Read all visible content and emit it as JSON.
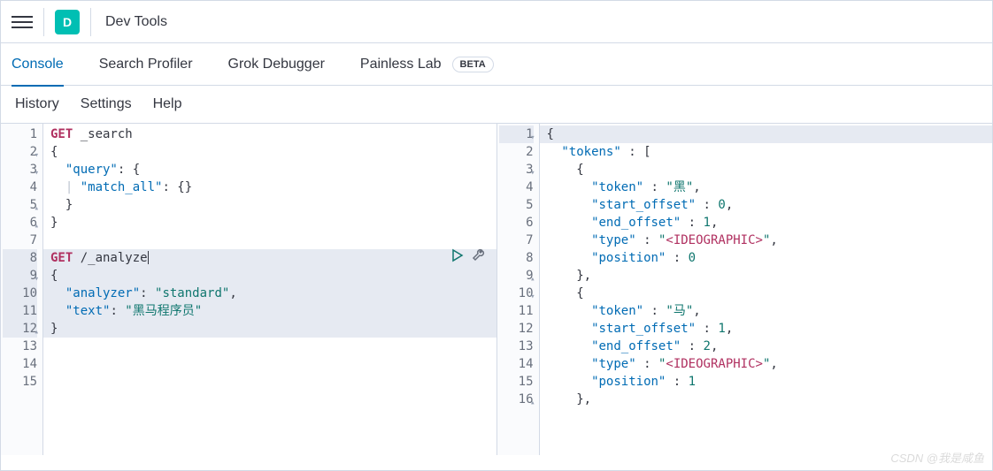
{
  "header": {
    "logo_letter": "D",
    "title": "Dev Tools"
  },
  "tabs": [
    {
      "label": "Console",
      "active": true
    },
    {
      "label": "Search Profiler"
    },
    {
      "label": "Grok Debugger"
    },
    {
      "label": "Painless Lab",
      "badge": "BETA"
    }
  ],
  "subtabs": [
    "History",
    "Settings",
    "Help"
  ],
  "request": {
    "lines": [
      {
        "n": 1,
        "tokens": [
          {
            "t": "GET ",
            "c": "method"
          },
          {
            "t": "_search",
            "c": "punct"
          }
        ]
      },
      {
        "n": 2,
        "fold": "▾",
        "tokens": [
          {
            "t": "{",
            "c": "punct"
          }
        ]
      },
      {
        "n": 3,
        "fold": "▾",
        "tokens": [
          {
            "t": "  ",
            "c": ""
          },
          {
            "t": "\"query\"",
            "c": "key"
          },
          {
            "t": ": {",
            "c": "punct"
          }
        ]
      },
      {
        "n": 4,
        "tokens": [
          {
            "t": "  ",
            "c": ""
          },
          {
            "t": "| ",
            "c": "pipe"
          },
          {
            "t": "\"match_all\"",
            "c": "key"
          },
          {
            "t": ": {}",
            "c": "punct"
          }
        ]
      },
      {
        "n": 5,
        "fold": "▴",
        "tokens": [
          {
            "t": "  }",
            "c": "punct"
          }
        ]
      },
      {
        "n": 6,
        "fold": "▴",
        "tokens": [
          {
            "t": "}",
            "c": "punct"
          }
        ]
      },
      {
        "n": 7,
        "tokens": []
      },
      {
        "n": 8,
        "hl": true,
        "cursor": true,
        "tokens": [
          {
            "t": "GET ",
            "c": "method"
          },
          {
            "t": "/_analyze",
            "c": "punct"
          }
        ]
      },
      {
        "n": 9,
        "hl": true,
        "fold": "▾",
        "tokens": [
          {
            "t": "{",
            "c": "punct"
          }
        ]
      },
      {
        "n": 10,
        "hl": true,
        "tokens": [
          {
            "t": "  ",
            "c": ""
          },
          {
            "t": "\"analyzer\"",
            "c": "key"
          },
          {
            "t": ": ",
            "c": "punct"
          },
          {
            "t": "\"standard\"",
            "c": "str"
          },
          {
            "t": ",",
            "c": "punct"
          }
        ]
      },
      {
        "n": 11,
        "hl": true,
        "tokens": [
          {
            "t": "  ",
            "c": ""
          },
          {
            "t": "\"text\"",
            "c": "key"
          },
          {
            "t": ": ",
            "c": "punct"
          },
          {
            "t": "\"黑马程序员\"",
            "c": "str"
          }
        ]
      },
      {
        "n": 12,
        "hl": true,
        "fold": "▴",
        "tokens": [
          {
            "t": "}",
            "c": "punct"
          }
        ]
      },
      {
        "n": 13,
        "tokens": []
      },
      {
        "n": 14,
        "tokens": []
      },
      {
        "n": 15,
        "tokens": []
      }
    ]
  },
  "response": {
    "lines": [
      {
        "n": 1,
        "hl": true,
        "fold": "▾",
        "tokens": [
          {
            "t": "{",
            "c": "punct"
          }
        ]
      },
      {
        "n": 2,
        "tokens": [
          {
            "t": "  ",
            "c": ""
          },
          {
            "t": "\"tokens\"",
            "c": "key"
          },
          {
            "t": " : [",
            "c": "punct"
          }
        ]
      },
      {
        "n": 3,
        "fold": "▾",
        "tokens": [
          {
            "t": "    {",
            "c": "punct"
          }
        ]
      },
      {
        "n": 4,
        "tokens": [
          {
            "t": "      ",
            "c": ""
          },
          {
            "t": "\"token\"",
            "c": "key"
          },
          {
            "t": " : ",
            "c": "punct"
          },
          {
            "t": "\"黑\"",
            "c": "str"
          },
          {
            "t": ",",
            "c": "punct"
          }
        ]
      },
      {
        "n": 5,
        "tokens": [
          {
            "t": "      ",
            "c": ""
          },
          {
            "t": "\"start_offset\"",
            "c": "key"
          },
          {
            "t": " : ",
            "c": "punct"
          },
          {
            "t": "0",
            "c": "num"
          },
          {
            "t": ",",
            "c": "punct"
          }
        ]
      },
      {
        "n": 6,
        "tokens": [
          {
            "t": "      ",
            "c": ""
          },
          {
            "t": "\"end_offset\"",
            "c": "key"
          },
          {
            "t": " : ",
            "c": "punct"
          },
          {
            "t": "1",
            "c": "num"
          },
          {
            "t": ",",
            "c": "punct"
          }
        ]
      },
      {
        "n": 7,
        "tokens": [
          {
            "t": "      ",
            "c": ""
          },
          {
            "t": "\"type\"",
            "c": "key"
          },
          {
            "t": " : ",
            "c": "punct"
          },
          {
            "t": "\"",
            "c": "str"
          },
          {
            "t": "<IDEOGRAPHIC>",
            "c": "ide"
          },
          {
            "t": "\"",
            "c": "str"
          },
          {
            "t": ",",
            "c": "punct"
          }
        ]
      },
      {
        "n": 8,
        "tokens": [
          {
            "t": "      ",
            "c": ""
          },
          {
            "t": "\"position\"",
            "c": "key"
          },
          {
            "t": " : ",
            "c": "punct"
          },
          {
            "t": "0",
            "c": "num"
          }
        ]
      },
      {
        "n": 9,
        "fold": "▴",
        "tokens": [
          {
            "t": "    },",
            "c": "punct"
          }
        ]
      },
      {
        "n": 10,
        "fold": "▾",
        "tokens": [
          {
            "t": "    {",
            "c": "punct"
          }
        ]
      },
      {
        "n": 11,
        "tokens": [
          {
            "t": "      ",
            "c": ""
          },
          {
            "t": "\"token\"",
            "c": "key"
          },
          {
            "t": " : ",
            "c": "punct"
          },
          {
            "t": "\"马\"",
            "c": "str"
          },
          {
            "t": ",",
            "c": "punct"
          }
        ]
      },
      {
        "n": 12,
        "tokens": [
          {
            "t": "      ",
            "c": ""
          },
          {
            "t": "\"start_offset\"",
            "c": "key"
          },
          {
            "t": " : ",
            "c": "punct"
          },
          {
            "t": "1",
            "c": "num"
          },
          {
            "t": ",",
            "c": "punct"
          }
        ]
      },
      {
        "n": 13,
        "tokens": [
          {
            "t": "      ",
            "c": ""
          },
          {
            "t": "\"end_offset\"",
            "c": "key"
          },
          {
            "t": " : ",
            "c": "punct"
          },
          {
            "t": "2",
            "c": "num"
          },
          {
            "t": ",",
            "c": "punct"
          }
        ]
      },
      {
        "n": 14,
        "tokens": [
          {
            "t": "      ",
            "c": ""
          },
          {
            "t": "\"type\"",
            "c": "key"
          },
          {
            "t": " : ",
            "c": "punct"
          },
          {
            "t": "\"",
            "c": "str"
          },
          {
            "t": "<IDEOGRAPHIC>",
            "c": "ide"
          },
          {
            "t": "\"",
            "c": "str"
          },
          {
            "t": ",",
            "c": "punct"
          }
        ]
      },
      {
        "n": 15,
        "tokens": [
          {
            "t": "      ",
            "c": ""
          },
          {
            "t": "\"position\"",
            "c": "key"
          },
          {
            "t": " : ",
            "c": "punct"
          },
          {
            "t": "1",
            "c": "num"
          }
        ]
      },
      {
        "n": 16,
        "fold": "▴",
        "tokens": [
          {
            "t": "    },",
            "c": "punct"
          }
        ]
      }
    ]
  },
  "watermark": "CSDN @我是咸鱼"
}
